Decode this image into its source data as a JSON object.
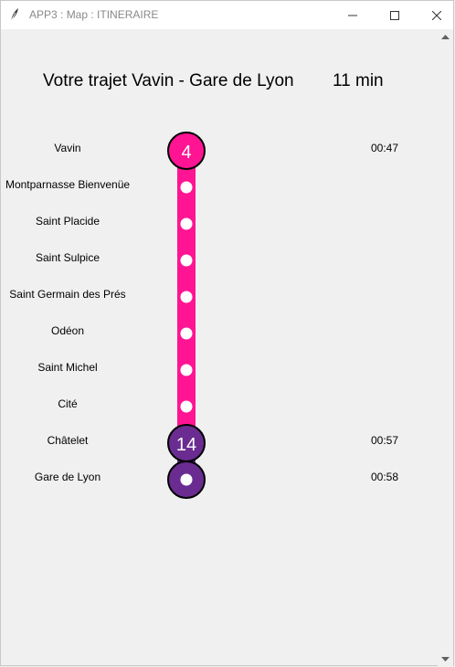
{
  "window": {
    "title": "APP3 : Map : ITINERAIRE"
  },
  "route": {
    "title": "Votre trajet Vavin - Gare de Lyon",
    "duration": "11 min"
  },
  "lines": [
    {
      "number": "4",
      "color": "#ff1493"
    },
    {
      "number": "14",
      "color": "#6a2c91"
    }
  ],
  "stations": [
    {
      "name": "Vavin",
      "time": "00:47",
      "marker": "line-badge",
      "line": "4"
    },
    {
      "name": "Montparnasse Bienvenüe",
      "time": "",
      "marker": "stop"
    },
    {
      "name": "Saint Placide",
      "time": "",
      "marker": "stop"
    },
    {
      "name": "Saint Sulpice",
      "time": "",
      "marker": "stop"
    },
    {
      "name": "Saint Germain des Prés",
      "time": "",
      "marker": "stop"
    },
    {
      "name": "Odéon",
      "time": "",
      "marker": "stop"
    },
    {
      "name": "Saint Michel",
      "time": "",
      "marker": "stop"
    },
    {
      "name": "Cité",
      "time": "",
      "marker": "stop"
    },
    {
      "name": "Châtelet",
      "time": "00:57",
      "marker": "line-badge",
      "line": "14"
    },
    {
      "name": "Gare de Lyon",
      "time": "00:58",
      "marker": "terminus"
    }
  ],
  "icons": {
    "app": "feather-icon",
    "minimize": "minimize-icon",
    "maximize": "maximize-icon",
    "close": "close-icon"
  }
}
